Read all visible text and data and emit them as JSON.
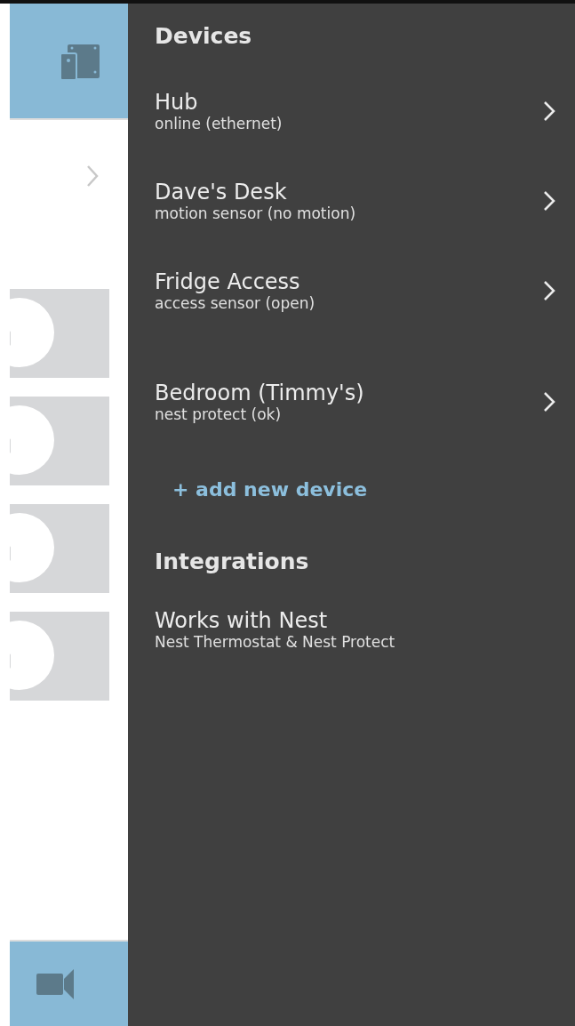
{
  "devices": {
    "title": "Devices",
    "items": [
      {
        "name": "Hub",
        "status": "online (ethernet)"
      },
      {
        "name": "Dave's Desk",
        "status": "motion sensor (no motion)"
      },
      {
        "name": "Fridge Access",
        "status": "access sensor (open)"
      },
      {
        "name": "Bedroom (Timmy's)",
        "status": "nest protect (ok)"
      }
    ],
    "add_label": "+ add new device"
  },
  "integrations": {
    "title": "Integrations",
    "items": [
      {
        "name": "Works with Nest",
        "status": "Nest Thermostat & Nest Protect"
      }
    ]
  }
}
